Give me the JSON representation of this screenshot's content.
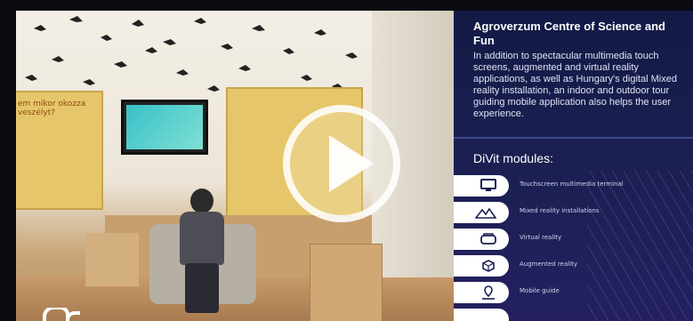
{
  "panel": {
    "title": "Agroverzum Centre of Science and Fun",
    "description": "In addition to spectacular multimedia touch screens, augmented and virtual reality applications, as well as Hungary's digital Mixed reality installation, an indoor and outdoor tour guiding mobile application also helps the user experience.",
    "modules_title": "DiVit modules:",
    "modules": [
      {
        "label": "Touchscreen multimedia terminal",
        "icon": "monitor-icon"
      },
      {
        "label": "Mixed reality installations",
        "icon": "mountains-icon"
      },
      {
        "label": "Virtual reality",
        "icon": "vr-headset-icon"
      },
      {
        "label": "Augmented reality",
        "icon": "ar-cube-icon"
      },
      {
        "label": "Mobile guide",
        "icon": "map-pin-icon"
      }
    ]
  },
  "video": {
    "play_icon": "play-icon",
    "signage": {
      "left_panel_text": "em mikor okozza veszélyt?",
      "right_panel_text": ""
    }
  },
  "colors": {
    "panel_bg": "#1a1f50",
    "accent": "#ffffff"
  }
}
